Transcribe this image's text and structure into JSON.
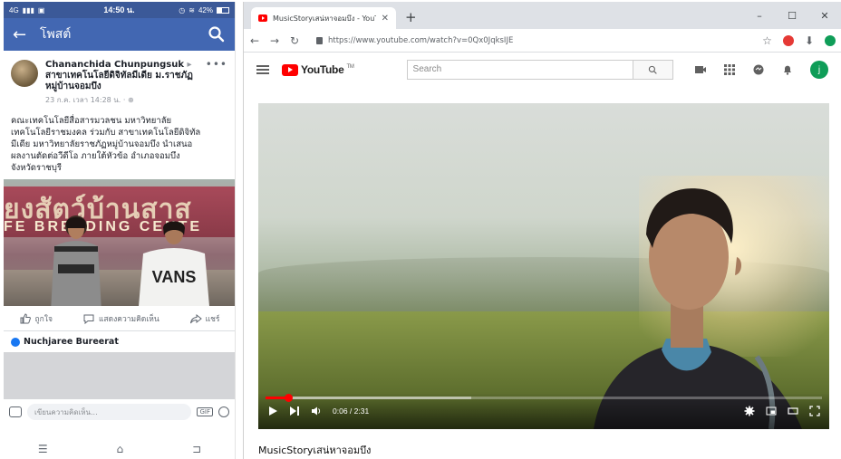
{
  "phone": {
    "status": {
      "carrier": "4G",
      "time": "14:50 น.",
      "battery": "42%"
    },
    "header": {
      "title": "โพสต์"
    },
    "post": {
      "author": "Chananchida Chunpungsuk",
      "group": "สาขาเทคโนโลยีดิจิทัลมีเดีย ม.ราชภัฏหมู่บ้านจอมบึง",
      "time": "23 ก.ค. เวลา 14:28 น. ·",
      "text": "คณะเทคโนโลยีสื่อสารมวลชน มหาวิทยาลัย\nเทคโนโลยีราชมงคล ร่วมกับ สาขาเทคโนโลยีดิจิทัล\nมีเดีย มหาวิทยาลัยราชภัฏหมู่บ้านจอมบึง นำเสนอ\nผลงานตัดต่อวีดีโอ ภายใต้หัวข้อ อำเภอจอมบึง\nจังหวัดราชบุรี",
      "photo_sign_text": "ยงสัตว์บ้านสาส",
      "photo_sign_sub": "FE BREEDING CENTE",
      "shirt_text": "VANS"
    },
    "actions": {
      "like": "ถูกใจ",
      "comment": "แสดงความคิดเห็น",
      "share": "แชร์"
    },
    "commenter": "Nuchjaree Bureerat",
    "comment_placeholder": "เขียนความคิดเห็น..."
  },
  "browser": {
    "tab_title": "MusicStoryเสน่หาจอมบึง - YouTube",
    "url": "https://www.youtube.com/watch?v=0Qx0JqksIJE",
    "youtube": {
      "logo_text": "YouTube",
      "logo_tm": "TM",
      "search_placeholder": "Search",
      "avatar_letter": "j"
    },
    "player": {
      "time_current": "0:06",
      "time_total": "2:31",
      "time_display": "0:06 / 2:31",
      "played_fraction": 0.04,
      "buffered_fraction": 0.37
    },
    "video_title": "MusicStoryเสน่หาจอมบึง"
  },
  "colors": {
    "fb_blue": "#4267b2",
    "fb_status": "#3b5998",
    "yt_red": "#ff0000",
    "avatar_green": "#0f9d58"
  }
}
